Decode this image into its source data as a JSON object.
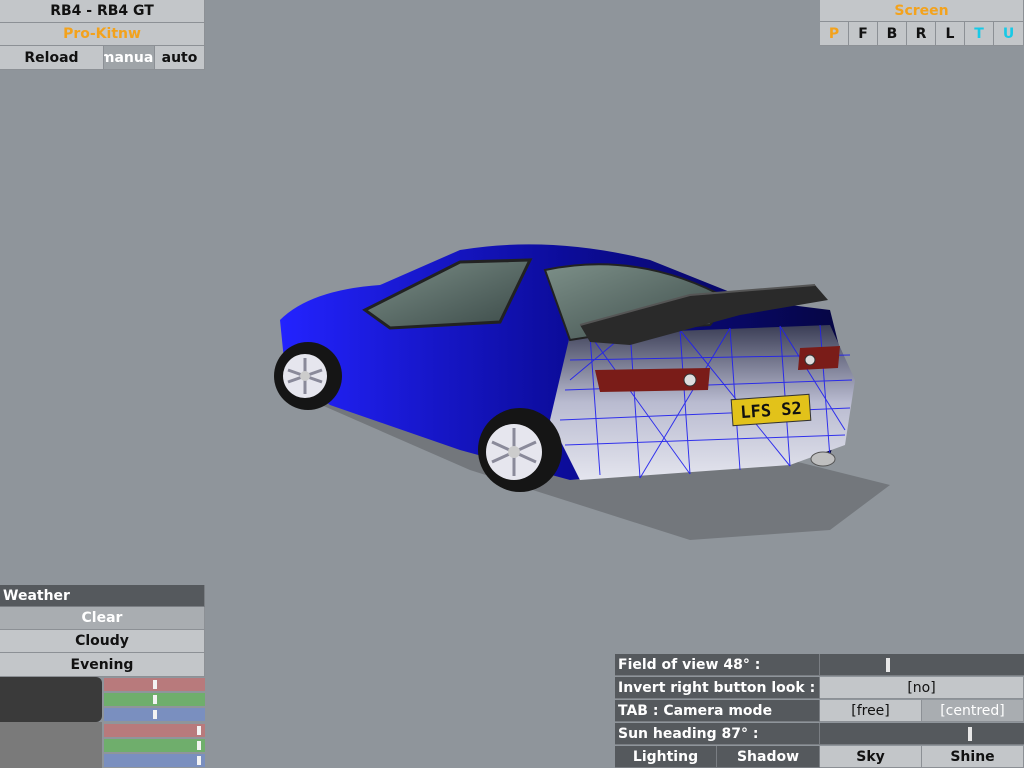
{
  "car": {
    "title": "RB4 - RB4 GT",
    "setup_name": "Pro-Kitnw",
    "reload_label": "Reload",
    "manual_label": "manual",
    "auto_label": "auto",
    "plate_text": "LFS S2"
  },
  "screen": {
    "title": "Screen",
    "views": [
      {
        "label": "P",
        "color": "#f3a21c"
      },
      {
        "label": "F",
        "color": "#111111"
      },
      {
        "label": "B",
        "color": "#111111"
      },
      {
        "label": "R",
        "color": "#111111"
      },
      {
        "label": "L",
        "color": "#111111"
      },
      {
        "label": "T",
        "color": "#17c9e6"
      },
      {
        "label": "U",
        "color": "#17c9e6"
      }
    ]
  },
  "weather": {
    "header": "Weather",
    "options": [
      "Clear",
      "Cloudy",
      "Evening"
    ],
    "sliders": [
      {
        "name": "upper-red",
        "color": "#b87a7c",
        "level": 0.5
      },
      {
        "name": "upper-green",
        "color": "#6fae6c",
        "level": 0.5
      },
      {
        "name": "upper-blue",
        "color": "#7a8fbf",
        "level": 0.5
      },
      {
        "name": "lower-red",
        "color": "#b87a7c",
        "level": 0.96
      },
      {
        "name": "lower-green",
        "color": "#6fae6c",
        "level": 0.96
      },
      {
        "name": "lower-blue",
        "color": "#7a8fbf",
        "level": 0.96
      }
    ]
  },
  "view_options": {
    "fov_label": "Field of view 48° :",
    "fov_level": 0.33,
    "invert_label": "Invert right button look :",
    "invert_value": "[no]",
    "camera_label": "TAB : Camera mode",
    "camera_free": "[free]",
    "camera_centred": "[centred]",
    "sun_label": "Sun heading 87° :",
    "sun_level": 0.74,
    "lighting_label": "Lighting",
    "shadow_label": "Shadow",
    "sky_label": "Sky",
    "shine_label": "Shine"
  },
  "colors": {
    "background": "#8f959b",
    "panel_light": "#c3c6c9",
    "panel_dark": "#55595d",
    "accent_orange": "#f3a21c",
    "accent_cyan": "#17c9e6",
    "car_body": "#1a1ae0"
  }
}
